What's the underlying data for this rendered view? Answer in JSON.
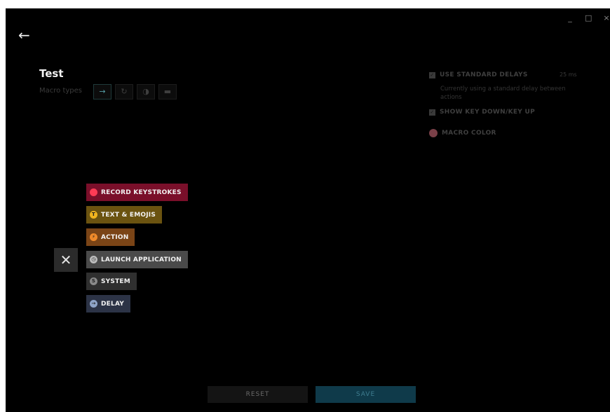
{
  "window": {
    "controls": [
      {
        "name": "minimize-button",
        "glyph": "_"
      },
      {
        "name": "maximize-button",
        "glyph": "□"
      },
      {
        "name": "close-window-button",
        "glyph": "×"
      }
    ]
  },
  "header": {
    "back_icon": "←",
    "title": "Test",
    "macro_types_label": "Macro types",
    "macro_types": [
      {
        "name": "macro-type-no-repeat",
        "icon": "arrow-right-icon",
        "glyph": "→",
        "active": true
      },
      {
        "name": "macro-type-repeat",
        "icon": "repeat-icon",
        "glyph": "↻",
        "active": false
      },
      {
        "name": "macro-type-toggle",
        "icon": "toggle-icon",
        "glyph": "◑",
        "active": false
      },
      {
        "name": "macro-type-sequence",
        "icon": "sequence-icon",
        "glyph": "▬",
        "active": false
      }
    ]
  },
  "settings": {
    "use_standard_delays": {
      "label": "USE STANDARD DELAYS",
      "checked": true,
      "value": "25 ms"
    },
    "delay_description": "Currently using a standard delay between actions",
    "show_key_down_up": {
      "label": "SHOW KEY DOWN/KEY UP",
      "checked": true
    },
    "macro_color": {
      "label": "MACRO COLOR",
      "color": "#7a4048"
    }
  },
  "menu": {
    "close_glyph": "✕",
    "items": [
      {
        "id": "record-keystrokes",
        "label": "RECORD KEYSTROKES",
        "icon": "record-icon",
        "glyph": "",
        "bg": "#7a0f2a",
        "icon_color": "#ff3b55"
      },
      {
        "id": "text-emojis",
        "label": "TEXT & EMOJIS",
        "icon": "text-icon",
        "glyph": "T",
        "bg": "#6b5310",
        "icon_color": "#f2b51e"
      },
      {
        "id": "action",
        "label": "ACTION",
        "icon": "action-icon",
        "glyph": "⚡",
        "bg": "#7a4416",
        "icon_color": "#f08a2a"
      },
      {
        "id": "launch-application",
        "label": "LAUNCH APPLICATION",
        "icon": "launch-icon",
        "glyph": "◷",
        "bg": "#4a4a4a",
        "icon_color": "#bdbdbd"
      },
      {
        "id": "system",
        "label": "SYSTEM",
        "icon": "system-icon",
        "glyph": "S",
        "bg": "#2f2f2f",
        "icon_color": "#8a8a8a"
      },
      {
        "id": "delay",
        "label": "DELAY",
        "icon": "delay-icon",
        "glyph": "→",
        "bg": "#2c3346",
        "icon_color": "#8fa4c8"
      }
    ]
  },
  "footer": {
    "reset_label": "RESET",
    "save_label": "SAVE",
    "reset_bg": "#141414",
    "save_bg": "#0f3a4a"
  }
}
